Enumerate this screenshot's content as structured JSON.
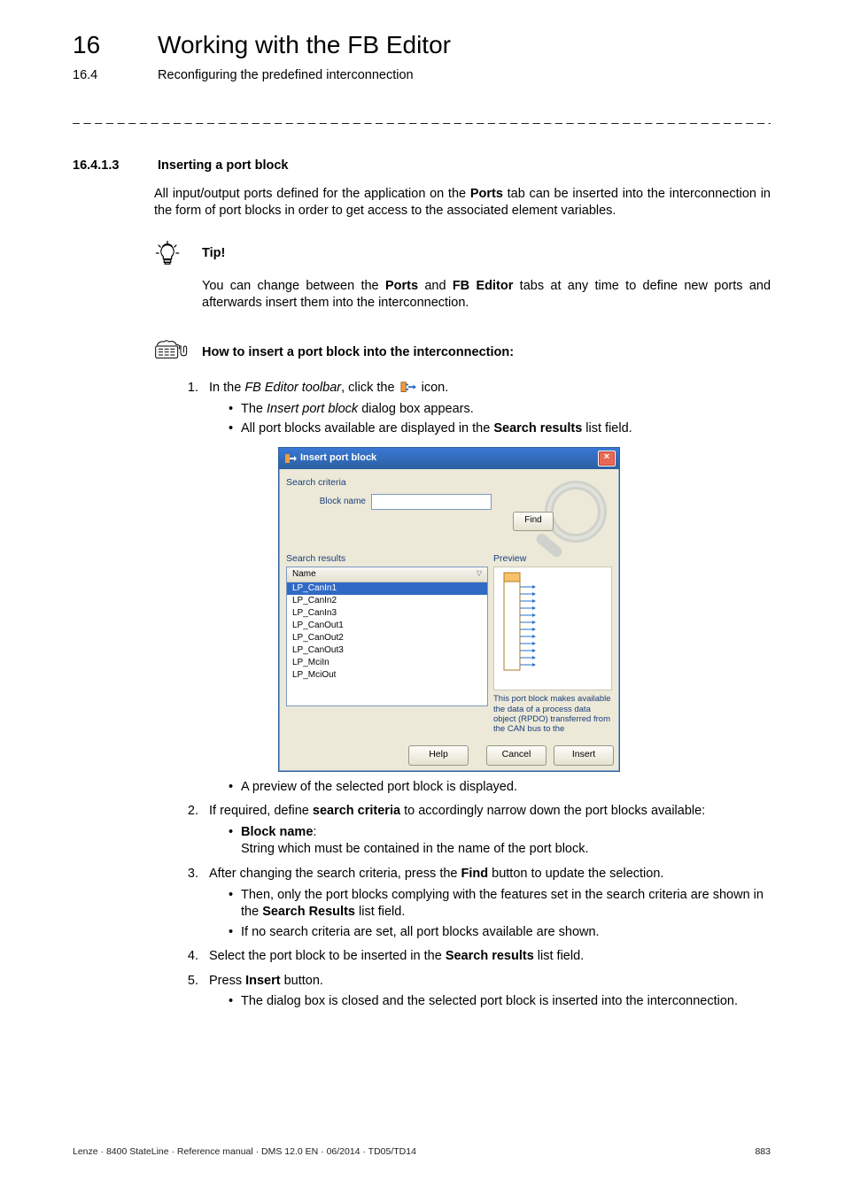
{
  "header": {
    "chapter_number": "16",
    "chapter_title": "Working with the FB Editor",
    "section_number": "16.4",
    "section_title": "Reconfiguring the predefined interconnection"
  },
  "divider": "_ _ _ _ _ _ _ _ _ _ _ _ _ _ _ _ _ _ _ _ _ _ _ _ _ _ _ _ _ _ _ _ _ _ _ _ _ _ _ _ _ _ _ _ _ _ _ _ _ _ _ _ _ _ _ _ _ _ _ _ _ _ _ _",
  "subsection": {
    "number": "16.4.1.3",
    "title": "Inserting a port block"
  },
  "intro": {
    "p1_a": "All input/output ports defined for the application on the ",
    "p1_ports": "Ports",
    "p1_b": " tab can be inserted into the interconnection in the form of port blocks in order to get access to the associated element variables."
  },
  "tip": {
    "label": "Tip!",
    "body_a": "You can change between the ",
    "body_ports": "Ports",
    "body_b": " and ",
    "body_fb": "FB Editor",
    "body_c": " tabs at any time to define new ports and afterwards insert them into the interconnection."
  },
  "howto": {
    "heading": "How to insert a port block into the interconnection:",
    "s1_a": "In the ",
    "s1_toolbar": "FB Editor toolbar",
    "s1_b": ", click the ",
    "s1_c": " icon.",
    "s1_b1_a": "The ",
    "s1_b1_dlg": "Insert port block",
    "s1_b1_b": " dialog box appears.",
    "s1_b2_a": "All port blocks available are displayed in the ",
    "s1_b2_sr": "Search results",
    "s1_b2_b": " list field.",
    "after_dialog_b1": "A preview of the selected port block is displayed.",
    "s2_a": "If required, define ",
    "s2_sc": "search criteria",
    "s2_b": " to accordingly narrow down the port blocks available:",
    "s2_bn_label": "Block name",
    "s2_bn_colon": ":",
    "s2_bn_desc": "String which must be contained in the name of the port block.",
    "s3_a": "After changing the search criteria, press the ",
    "s3_find": "Find",
    "s3_b": " button to update the selection.",
    "s3_b1_a": "Then, only the port blocks complying with the features set in the search criteria are shown in the ",
    "s3_b1_sr": "Search Results",
    "s3_b1_b": " list field.",
    "s3_b2": "If no search criteria are set, all port blocks available are shown.",
    "s4_a": "Select the port block to be inserted in the ",
    "s4_sr": "Search results",
    "s4_b": " list field.",
    "s5_a": "Press ",
    "s5_ins": "Insert",
    "s5_b": " button.",
    "s5_b1": "The dialog box is closed and the selected port block is inserted into the interconnection."
  },
  "dialog": {
    "title": "Insert port block",
    "search_criteria": "Search criteria",
    "block_name": "Block name",
    "find": "Find",
    "search_results": "Search results",
    "preview": "Preview",
    "col_name": "Name",
    "items": [
      "LP_CanIn1",
      "LP_CanIn2",
      "LP_CanIn3",
      "LP_CanOut1",
      "LP_CanOut2",
      "LP_CanOut3",
      "LP_MciIn",
      "LP_MciOut"
    ],
    "preview_caption": "This port block makes available the data of a process data object (RPDO) transferred from the CAN bus to the",
    "help": "Help",
    "cancel": "Cancel",
    "insert": "Insert"
  },
  "footer": {
    "left": "Lenze · 8400 StateLine · Reference manual · DMS 12.0 EN · 06/2014 · TD05/TD14",
    "right": "883"
  }
}
